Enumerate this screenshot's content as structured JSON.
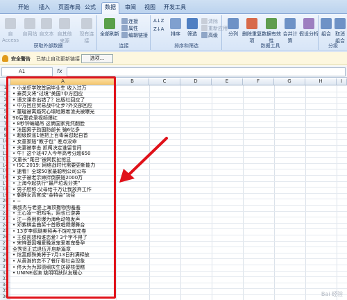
{
  "tabs": [
    {
      "label": "开始",
      "active": false
    },
    {
      "label": "插入",
      "active": false
    },
    {
      "label": "页面布局",
      "active": false
    },
    {
      "label": "公式",
      "active": false
    },
    {
      "label": "数据",
      "active": true
    },
    {
      "label": "审阅",
      "active": false
    },
    {
      "label": "视图",
      "active": false
    },
    {
      "label": "开发工具",
      "active": false
    }
  ],
  "ribbon": {
    "external": {
      "title": "获取外部数据",
      "items": [
        "自 Access",
        "自网站",
        "自文本",
        "自其他来源",
        "现有连接"
      ]
    },
    "connections": {
      "title": "连接",
      "refresh": "全部刷新",
      "items": [
        "连接",
        "属性",
        "编辑链接"
      ]
    },
    "sort": {
      "title": "排序和筛选",
      "sort_az": "A↓Z",
      "sort_za": "Z↓A",
      "sort": "排序",
      "filter": "筛选",
      "items": [
        "清除",
        "重新应用",
        "高级"
      ]
    },
    "tools": {
      "title": "数据工具",
      "items": [
        "分列",
        "删除重复项",
        "数据有效性",
        "合并计算",
        "假设分析"
      ]
    },
    "outline": {
      "title": "分级",
      "items": [
        "组合",
        "取消组合"
      ]
    }
  },
  "security": {
    "title": "安全警告",
    "message": "已禁止自动更新链接",
    "button": "选项..."
  },
  "formula": {
    "namebox": "A1",
    "fx": "fx",
    "content": ""
  },
  "grid": {
    "columns": [
      "A",
      "B",
      "C",
      "D",
      "E",
      "F",
      "G",
      "H",
      "I",
      "J"
    ],
    "rows": [
      "1",
      "2",
      "3",
      "4",
      "5",
      "6",
      "7",
      "8",
      "9",
      "10",
      "11",
      "12",
      "13",
      "14",
      "15",
      "16",
      "17",
      "18",
      "19",
      "20",
      "21",
      "22",
      "23",
      "24",
      "25",
      "26",
      "27",
      "28",
      "29",
      "30",
      "31",
      "32",
      "33",
      "34",
      "35",
      "36"
    ],
    "cells": [
      "• 小龙虾学院首届毕业生 收入过万",
      "• 泰英文将“过境”美国?中方回应",
      "• 语文课本出错了？出版社回应了",
      "• 中方回应贸易战中让步?外交部回应",
      "• 董璇被离婚死心塌地跟着渣夫被曝光",
      "90后警花录视频爆红",
      "• 8秒钟蝙蝠吊 这俩国家竞然翻脸",
      "• 法国男子劲国防部长 骗6亿多",
      "• 超级跌涨1他把上百毒枭怼起自首",
      "• 女童家赔“教子包” 差点没命",
      "• 夫妻被拳击 抓阄决定谁留世间",
      "• 牛！这个班47人今年高考分超650",
      "文童长“尾巴”被网民扯挖显",
      "• ISC 2019: 网络战时代需要更新能力",
      "• 速看！全球50家最聪明公司公布",
      "• 女子被老示婶拌倒获赔2000万",
      "• 上海今起执行“最严垃圾分类”",
      "• 男子腔称:父母给千万让我放弃工作",
      "• 朝鲜女高官成“金特会”功臣",
      "• ~",
      "表叔杰与老婆上海顶撒物狗羞羞",
      "• 王心凌一把鸡毛，陌也已逆袭",
      "• 江一燕用影爆为海龟动物发声",
      "• 邓紫棋金曲奖十首歌唱燃爆舞台",
      "• 13岁李佩璐美照再不饶吃宠花卷",
      "• 王俊凯想和谁恋爱? 3个字不得了",
      "• 宋祥基因嘎爱晚发宠爱着宠备孕",
      "全秀贤正式退伍开启新篇章",
      "• 炫富颜殊美将于7月13日刑满释放",
      "• 从黄渤的恋不了餐厅看社会现象",
      "• 佟大为为郭德纲庆生送硬核蛋糕",
      "• UNINE巡演 姚明明扶队友暖心"
    ]
  }
}
